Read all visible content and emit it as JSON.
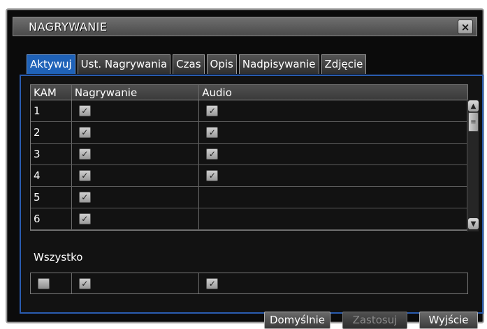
{
  "window": {
    "title": "NAGRYWANIE",
    "close_label": "×"
  },
  "tabs": [
    {
      "label": "Aktywuj",
      "active": true
    },
    {
      "label": "Ust. Nagrywania",
      "active": false
    },
    {
      "label": "Czas",
      "active": false
    },
    {
      "label": "Opis",
      "active": false
    },
    {
      "label": "Nadpisywanie",
      "active": false
    },
    {
      "label": "Zdjęcie",
      "active": false
    }
  ],
  "table": {
    "headers": {
      "cam": "KAM",
      "record": "Nagrywanie",
      "audio": "Audio"
    },
    "rows": [
      {
        "cam": "1",
        "record": true,
        "audio": true
      },
      {
        "cam": "2",
        "record": true,
        "audio": true
      },
      {
        "cam": "3",
        "record": true,
        "audio": true
      },
      {
        "cam": "4",
        "record": true,
        "audio": true
      },
      {
        "cam": "5",
        "record": true,
        "audio": false
      },
      {
        "cam": "6",
        "record": true,
        "audio": false
      }
    ]
  },
  "all": {
    "label": "Wszystko",
    "cam": false,
    "record": true,
    "audio": true
  },
  "buttons": {
    "default": "Domyślnie",
    "apply": "Zastosuj",
    "exit": "Wyjście"
  },
  "glyphs": {
    "check": "✓",
    "up": "▲",
    "down": "▼",
    "grip": "≡"
  },
  "colors": {
    "accent": "#1f62b8",
    "panel_border": "#2a5cb0"
  }
}
